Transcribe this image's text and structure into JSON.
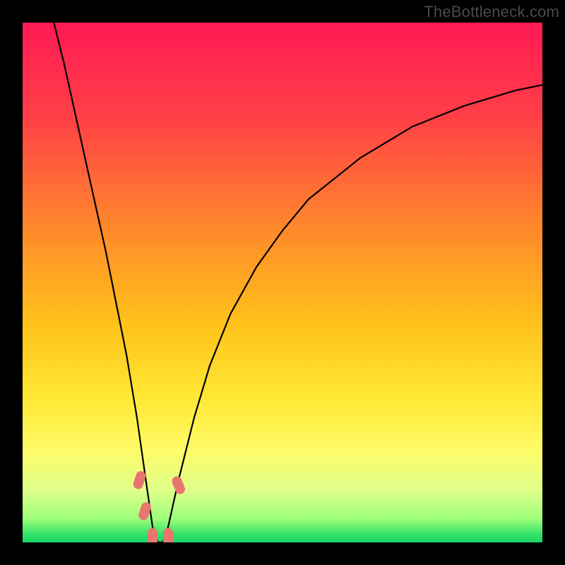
{
  "watermark": "TheBottleneck.com",
  "chart_data": {
    "type": "line",
    "title": "",
    "xlabel": "",
    "ylabel": "",
    "xlim": [
      0,
      100
    ],
    "ylim": [
      0,
      100
    ],
    "background": {
      "type": "vertical-gradient",
      "stops": [
        {
          "pos": 0.0,
          "color": "#ff1a53"
        },
        {
          "pos": 0.18,
          "color": "#ff3f47"
        },
        {
          "pos": 0.4,
          "color": "#ff8a2a"
        },
        {
          "pos": 0.58,
          "color": "#ffc21a"
        },
        {
          "pos": 0.72,
          "color": "#ffe733"
        },
        {
          "pos": 0.82,
          "color": "#fffb66"
        },
        {
          "pos": 0.9,
          "color": "#dfff8a"
        },
        {
          "pos": 0.955,
          "color": "#9cff7a"
        },
        {
          "pos": 0.985,
          "color": "#34e06a"
        },
        {
          "pos": 1.0,
          "color": "#17d463"
        }
      ]
    },
    "series": [
      {
        "name": "bottleneck-curve",
        "color": "#000000",
        "x": [
          6,
          8,
          10,
          12,
          14,
          16,
          18,
          20,
          22,
          24,
          25,
          26,
          27,
          28,
          30,
          33,
          36,
          40,
          45,
          50,
          55,
          60,
          65,
          70,
          75,
          80,
          85,
          90,
          95,
          100
        ],
        "y": [
          100,
          92,
          83,
          74,
          65,
          56,
          46,
          36,
          24,
          10,
          3,
          0,
          0,
          3,
          12,
          24,
          34,
          44,
          53,
          60,
          66,
          70,
          74,
          77,
          80,
          82,
          84,
          85.5,
          87,
          88
        ]
      }
    ],
    "markers": [
      {
        "name": "marker-left-upper",
        "x": 22.5,
        "y": 12,
        "color": "#e8766f"
      },
      {
        "name": "marker-left-mid",
        "x": 23.5,
        "y": 6,
        "color": "#e8766f"
      },
      {
        "name": "marker-trough-left",
        "x": 25.0,
        "y": 1,
        "color": "#e8766f"
      },
      {
        "name": "marker-trough-right",
        "x": 28.0,
        "y": 1,
        "color": "#e8766f"
      },
      {
        "name": "marker-right-rise",
        "x": 30.0,
        "y": 11,
        "color": "#e8766f"
      }
    ]
  }
}
